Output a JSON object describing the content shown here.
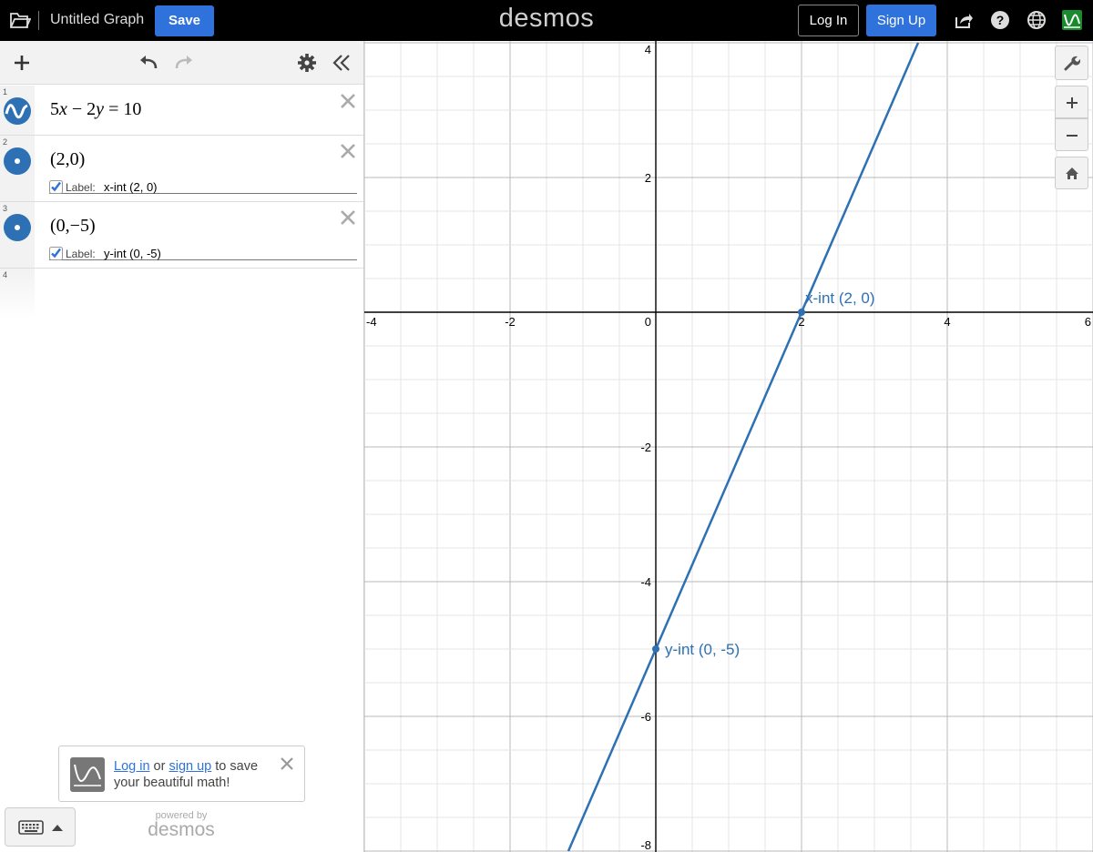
{
  "topbar": {
    "title": "Untitled Graph",
    "save_label": "Save",
    "logo": "desmos",
    "login_label": "Log In",
    "signup_label": "Sign Up",
    "icons": [
      "folder-icon",
      "share-icon",
      "help-icon",
      "language-icon",
      "app-badge-icon"
    ]
  },
  "panel": {
    "toolbar_icons": [
      "add-icon",
      "undo-icon",
      "redo-icon",
      "gear-icon",
      "collapse-panel-icon"
    ],
    "expressions": [
      {
        "num": "1",
        "type": "equation",
        "latex": "5x − 2y = 10",
        "parts": [
          "5",
          "x",
          " − 2",
          "y",
          " = 10"
        ]
      },
      {
        "num": "2",
        "type": "point",
        "math": "(2,0)",
        "label_word": "Label:",
        "label_value": "x-int (2, 0)",
        "label_checked": true
      },
      {
        "num": "3",
        "type": "point",
        "math": "(0,−5)",
        "label_word": "Label:",
        "label_value": "y-int (0, -5)",
        "label_checked": true
      },
      {
        "num": "4",
        "type": "empty"
      }
    ],
    "notice": {
      "login_link": "Log in",
      "or": "or",
      "signup_link": "sign up",
      "rest": "to save your beautiful math!"
    },
    "powered_by": "powered by",
    "powered_logo": "desmos"
  },
  "colors": {
    "line": "#2d70b3",
    "accent": "#2f72dc",
    "topbar": "#000000"
  },
  "chart_data": {
    "type": "line",
    "equation": "5x - 2y = 10",
    "xlim": [
      -4,
      6
    ],
    "ylim": [
      -8.2,
      4
    ],
    "x_ticks": [
      "-4",
      "-2",
      "0",
      "2",
      "4",
      "6"
    ],
    "y_ticks": [
      "4",
      "2",
      "-2",
      "-4",
      "-6",
      "-8"
    ],
    "grid": true,
    "series": [
      {
        "x": [
          -1.2,
          3.6
        ],
        "y": [
          -8,
          4
        ]
      }
    ],
    "points": [
      {
        "x": 2,
        "y": 0,
        "label": "x-int (2, 0)"
      },
      {
        "x": 0,
        "y": -5,
        "label": "y-int (0, -5)"
      }
    ]
  }
}
